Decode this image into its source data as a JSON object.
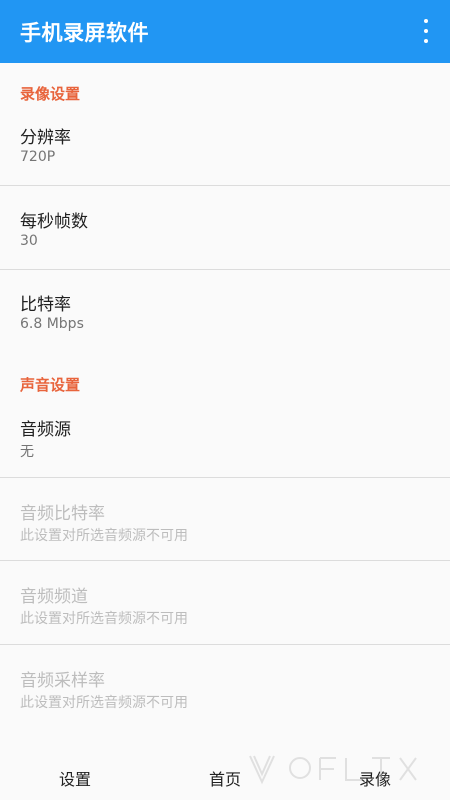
{
  "appbar": {
    "title": "手机录屏软件",
    "menu_icon": "more-vert-icon"
  },
  "sections": {
    "video": {
      "header": "录像设置",
      "items": [
        {
          "title": "分辨率",
          "summary": "720P"
        },
        {
          "title": "每秒帧数",
          "summary": "30"
        },
        {
          "title": "比特率",
          "summary": "6.8 Mbps"
        }
      ]
    },
    "audio": {
      "header": "声音设置",
      "items": [
        {
          "title": "音频源",
          "summary": "无"
        },
        {
          "title": "音频比特率",
          "summary": "此设置对所选音频源不可用"
        },
        {
          "title": "音频频道",
          "summary": "此设置对所选音频源不可用"
        },
        {
          "title": "音频采样率",
          "summary": "此设置对所选音频源不可用"
        }
      ]
    }
  },
  "bottom_nav": {
    "tabs": [
      "设置",
      "首页",
      "录像"
    ]
  },
  "colors": {
    "primary": "#2196f3",
    "accent": "#e8643c",
    "disabled": "#bdbdbd"
  }
}
